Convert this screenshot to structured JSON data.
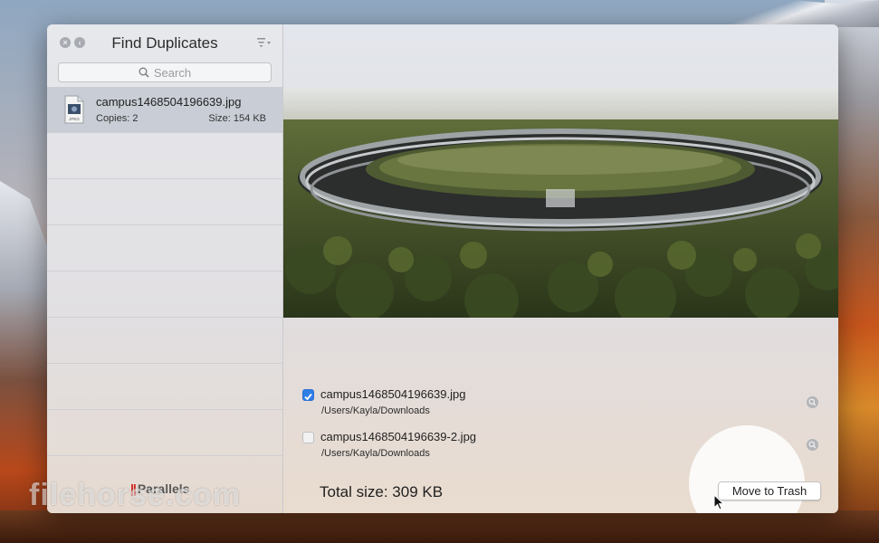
{
  "window": {
    "title": "Find Duplicates",
    "search_placeholder": "Search"
  },
  "sidebar": {
    "items": [
      {
        "name": "campus1468504196639.jpg",
        "copies": "Copies: 2",
        "size": "Size: 154 KB",
        "icon": "jpeg-file-icon",
        "selected": true
      }
    ],
    "brand": "Parallels"
  },
  "preview": {
    "image": "apple-campus-aerial-photo"
  },
  "duplicates": [
    {
      "name": "campus1468504196639.jpg",
      "path": "/Users/Kayla/Downloads",
      "checked": true
    },
    {
      "name": "campus1468504196639-2.jpg",
      "path": "/Users/Kayla/Downloads",
      "checked": false
    }
  ],
  "footer": {
    "total": "Total size: 309 KB",
    "move_button": "Move to Trash"
  },
  "watermark": "filehorse.com",
  "colors": {
    "accent": "#2f7ee6",
    "selected_row": "#c9ced6",
    "brand_red": "#d0201b"
  }
}
